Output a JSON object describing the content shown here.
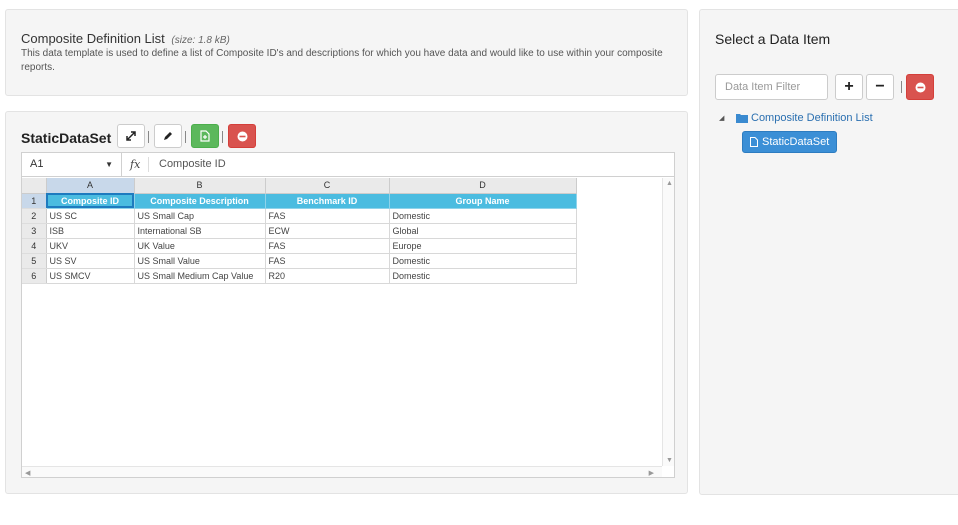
{
  "info": {
    "title": "Composite Definition List",
    "size": "(size: 1.8 kB)",
    "description": "This data template is used to define a list of Composite ID's and descriptions for which you have data and would like to use within your composite reports."
  },
  "dataset": {
    "title": "StaticDataSet",
    "toolbar": {
      "expand_icon": "expand-icon",
      "edit_icon": "pencil-icon",
      "save_icon": "save-file-icon",
      "delete_icon": "minus-circle-icon"
    },
    "colors": {
      "save": "#5cb85c",
      "delete": "#d9534f"
    }
  },
  "spreadsheet": {
    "cell_ref": "A1",
    "fx_label": "fx",
    "formula_value": "Composite ID",
    "column_letters": [
      "A",
      "B",
      "C",
      "D"
    ],
    "row_numbers": [
      "1",
      "2",
      "3",
      "4",
      "5",
      "6"
    ],
    "header_row": [
      "Composite ID",
      "Composite Description",
      "Benchmark ID",
      "Group Name"
    ],
    "rows": [
      [
        "US SC",
        "US Small Cap",
        "FAS",
        "Domestic"
      ],
      [
        "ISB",
        "International SB",
        "ECW",
        "Global"
      ],
      [
        "UKV",
        "UK Value",
        "FAS",
        "Europe"
      ],
      [
        "US SV",
        "US Small Value",
        "FAS",
        "Domestic"
      ],
      [
        "US SMCV",
        "US Small Medium Cap Value",
        "R20",
        "Domestic"
      ]
    ],
    "header_color": "#4bbce0"
  },
  "selector": {
    "title": "Select a Data Item",
    "filter_placeholder": "Data Item Filter",
    "add_label": "+",
    "remove_label": "−",
    "tree": {
      "folder_label": "Composite Definition List",
      "leaf_label": "StaticDataSet"
    },
    "colors": {
      "selected": "#3b8fd6",
      "folder": "#2a6fb0"
    }
  }
}
